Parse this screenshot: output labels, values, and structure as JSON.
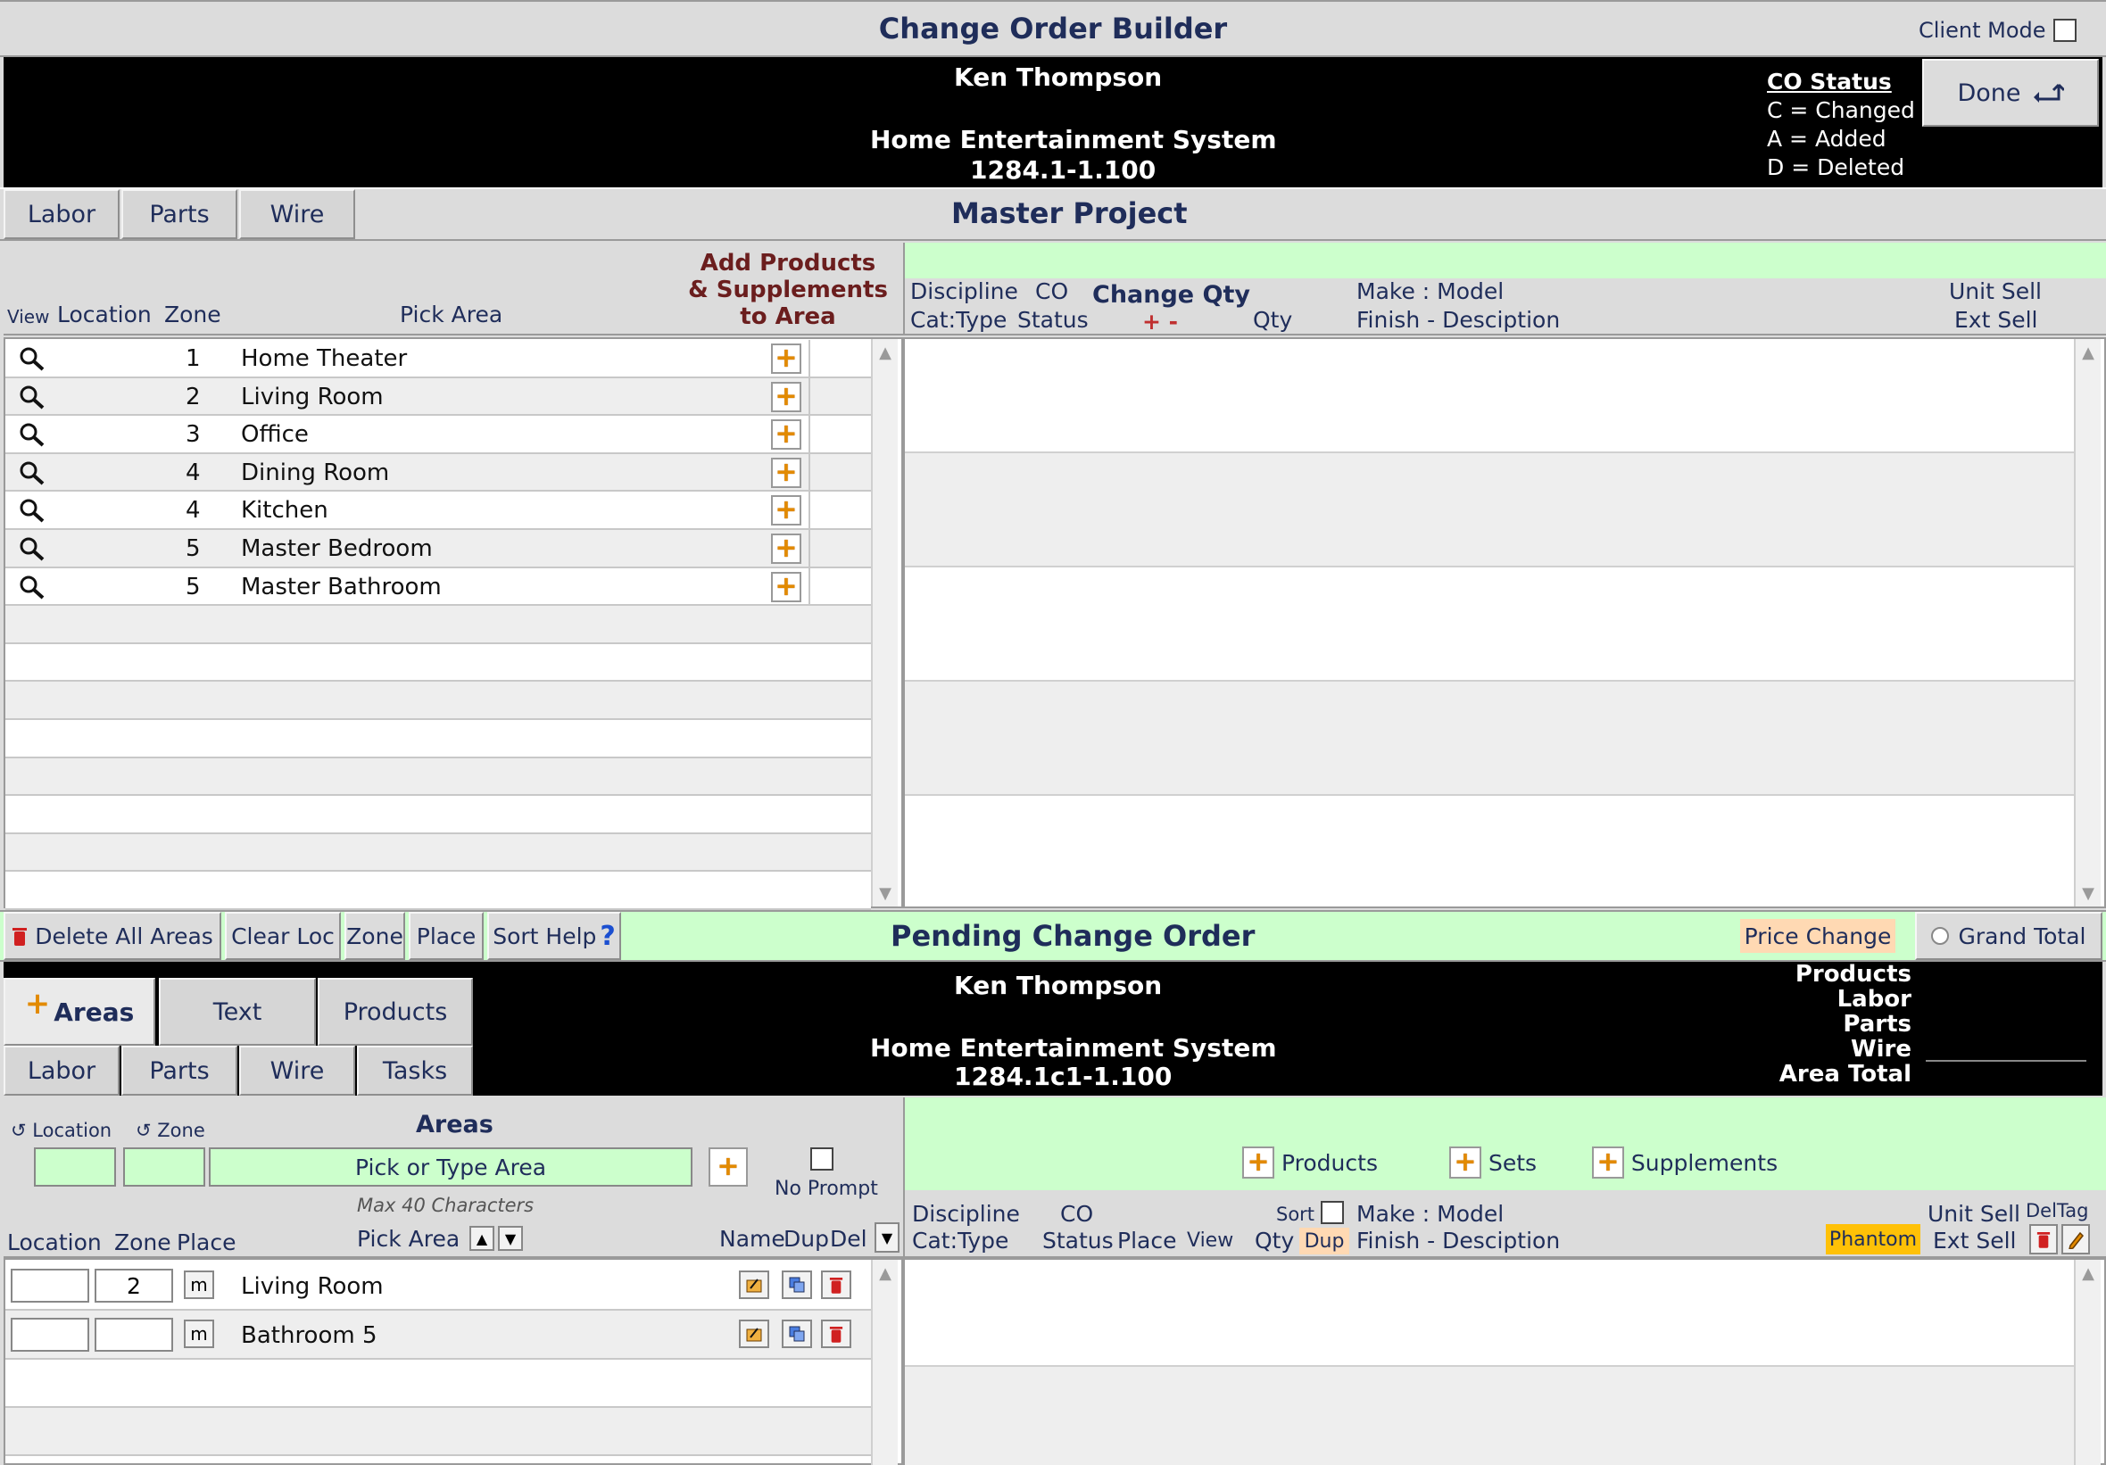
{
  "window": {
    "title": "Change Order Builder",
    "client_mode_label": "Client Mode",
    "client_mode_checked": false
  },
  "header": {
    "client": "Ken Thompson",
    "project": "Home Entertainment System",
    "project_id": "1284.1-1.100",
    "co_status": {
      "title": "CO Status",
      "lines": [
        "C = Changed",
        "A = Added",
        "D = Deleted"
      ]
    },
    "done_label": "Done"
  },
  "master_tabs": {
    "labor": "Labor",
    "parts": "Parts",
    "wire": "Wire",
    "title": "Master Project"
  },
  "area_table": {
    "headers": {
      "view": "View",
      "location": "Location",
      "zone": "Zone",
      "pick_area": "Pick Area",
      "add_products": [
        "Add Products",
        "& Supplements",
        "to Area"
      ]
    },
    "rows": [
      {
        "zone": "1",
        "area": "Home Theater"
      },
      {
        "zone": "2",
        "area": "Living Room"
      },
      {
        "zone": "3",
        "area": "Office"
      },
      {
        "zone": "4",
        "area": "Dining Room"
      },
      {
        "zone": "4",
        "area": "Kitchen"
      },
      {
        "zone": "5",
        "area": "Master Bedroom"
      },
      {
        "zone": "5",
        "area": "Master Bathroom"
      }
    ]
  },
  "product_headers": {
    "discipline": "Discipline",
    "cat_type": "Cat:Type",
    "co": "CO",
    "status": "Status",
    "change_qty": "Change Qty",
    "plus_minus": "+  -",
    "qty": "Qty",
    "make_model": "Make : Model",
    "finish_desc": "Finish - Desciption",
    "unit_sell": "Unit Sell",
    "ext_sell": "Ext Sell"
  },
  "action_bar": {
    "delete_all": "Delete All Areas",
    "clear_loc": "Clear Loc",
    "zone": "Zone",
    "place": "Place",
    "sort_help": "Sort Help",
    "help_mark": "?",
    "pending_title": "Pending Change Order",
    "price_change": "Price Change",
    "grand_total": "Grand Total"
  },
  "pending": {
    "client": "Ken Thompson",
    "project": "Home Entertainment System",
    "project_id": "1284.1c1-1.100",
    "tabs": {
      "areas": "Areas",
      "text": "Text",
      "products": "Products",
      "labor": "Labor",
      "parts": "Parts",
      "wire": "Wire",
      "tasks": "Tasks"
    },
    "totals": [
      "Products",
      "Labor",
      "Parts",
      "Wire",
      "Area Total"
    ]
  },
  "area_editor": {
    "location": "Location",
    "zone": "Zone",
    "areas": "Areas",
    "placeholder": "Pick or Type Area",
    "max_chars": "Max 40 Characters",
    "no_prompt": "No Prompt",
    "col_location": "Location",
    "col_zone": "Zone",
    "col_place": "Place",
    "col_pick_area": "Pick Area",
    "col_name": "Name",
    "col_dup": "Dup",
    "col_del": "Del",
    "rows": [
      {
        "location": "",
        "zone": "2",
        "place": "m",
        "area": "Living Room"
      },
      {
        "location": "",
        "zone": "",
        "place": "m",
        "area": "Bathroom 5"
      }
    ]
  },
  "pending_products": {
    "products_btn": "Products",
    "sets_btn": "Sets",
    "supplements_btn": "Supplements",
    "discipline": "Discipline",
    "cat_type": "Cat:Type",
    "co": "CO",
    "status": "Status",
    "place": "Place",
    "view": "View",
    "sort": "Sort",
    "qty": "Qty",
    "dup": "Dup",
    "make_model": "Make : Model",
    "finish_desc": "Finish - Desciption",
    "phantom": "Phantom",
    "unit_sell": "Unit Sell",
    "ext_sell": "Ext Sell",
    "del_tag": "DelTag"
  },
  "colors": {
    "accent_green": "#ccffcc",
    "title_navy": "#1f2d5a",
    "orange_plus": "#e28a00",
    "price_change_bg": "#ffd9b3",
    "phantom_bg": "#ffc107",
    "delete_red": "#d02020"
  }
}
